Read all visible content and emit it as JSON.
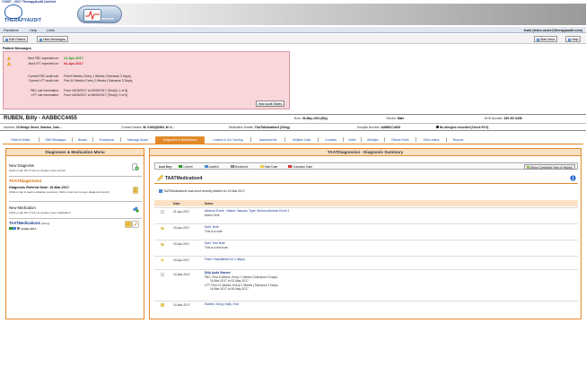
{
  "header": {
    "copyright": "©2007 - 2017 TherapyAudit Limited",
    "logo_text": "THERAPYAUDIT",
    "monitor_text": "MONITOR"
  },
  "menu": {
    "items": [
      "Functions",
      "Help",
      "Links"
    ],
    "user": "lewis (lewis.carter@therapyaudit.com)"
  },
  "toolbar": {
    "edit_patient": "Edit Patient",
    "hide_messages": "Hide Messages",
    "start_here": "Start Here",
    "help": "Help"
  },
  "patient_messages": {
    "title": "Patient Messages",
    "next_fbc_label": "Next FBC expected on:",
    "next_fbc_value": "21-Apr-2017",
    "next_lft_label": "Next LFT expected on:",
    "next_lft_value": "04-Apr-2017",
    "current_fbc_label": "Current FBC audit rule:",
    "current_fbc_value": "First 6 Weeks, Every 1 Weeks (Tolerance 3 Days)",
    "current_lft_label": "Current LFT audit rule:",
    "current_lft_value": "First 10 Weeks, Every 2 Weeks (Tolerance 3 Days)",
    "fbc_info_label": "FBC rule information:",
    "fbc_info_value": "From 16/03/2017 to 02/05/2017 (Test(s): 1 of 6)",
    "lft_info_label": "LFT rule information:",
    "lft_info_value": "From 16/03/2017 to 06/05/2017 (Test(s): 0 of 5)",
    "hide_audit_btn": "Hide Audit Tables"
  },
  "patient": {
    "name": "RUBEN, Billy - AABBCC4455",
    "born": "03-May-1910 (89y)",
    "gender": "Male",
    "nhs_number": "345 267 6458",
    "address": "10 Bridge Street, Staxton, Cam...",
    "contact": "W: 0169(0)0493, M: 0...",
    "medication": "TAATMedication4 (20mg)",
    "hospital_number": "AABBCC4455",
    "allergies": "No allergies recorded (Check Fit 5)",
    "born_label": "Born:",
    "gender_label": "Gender:",
    "nhs_label": "NHS Number:",
    "address_label": "Address:",
    "contact_label": "Contact Details:",
    "medication_label": "Medication Details:",
    "hospital_label": "Hospital Number:"
  },
  "tabs": [
    "Patient Details",
    "SMS Messages",
    "Bloods",
    "Exceptions",
    "Message Board",
    "Diagnoses & Medications",
    "Unseen & Sol. Scoring",
    "Assessments",
    "Helpline Calls",
    "Contacts",
    "Notes",
    "Allergies",
    "Patient Roles",
    "DNA Letters",
    "Reports"
  ],
  "left_panel": {
    "title": "Diagnoses & Medication Menu",
    "new_diagnosis": "New Diagnosis",
    "new_diagnosis_sub": "(Click or tap this ® icon to create a new record)",
    "diag_heading": "TAATDiagnosis4",
    "referral_title": "Diagnosis Referral Date: 10-Mar-2017",
    "referral_sub": "(Click or tap to load medication summary. Click or tap icon to open diagnosis record)",
    "new_medication": "New Medication",
    "new_medication_sub": "(Click or tap this ® icon to create a new medication)",
    "med_title": "TAATMedication4",
    "med_dose": "(20mg)",
    "med_date": "10-Mar-2017"
  },
  "right_panel": {
    "title": "TAATDiagnosis4 - Diagnosis Summary",
    "key_label": "Icon Key:",
    "keys": [
      "Current",
      "Audited",
      "Monitored",
      "Start Date",
      "Cessation Date"
    ],
    "show_combined": "(Show Combined View of Histoty)",
    "med_name": "TAATMedication4",
    "started_note": "TAATMedication4 was most recently started on 10-Mar-2017",
    "col_date": "Date",
    "col_notes": "Notes",
    "rows": [
      {
        "date": "21-Apr-2017",
        "l1": "Adverse Event - Nature: Nausea, Type: Serious Adverse Event 1",
        "l2": "Notes Here",
        "l3": "",
        "l4": ""
      },
      {
        "date": "19-Apr-2017",
        "l1": "Note: Note",
        "l2": "This is a note",
        "l3": "",
        "l4": ""
      },
      {
        "date": "19-Apr-2017",
        "l1": "Note: Test Note",
        "l2": "This is a test note",
        "l3": "",
        "l4": ""
      },
      {
        "date": "19-Apr-2017",
        "l1": "Flare: Hospitalised for 2 day(s)",
        "l2": "",
        "l3": "",
        "l4": ""
      },
      {
        "date": "10-Mar-2017",
        "l1": "DNA Audit Started",
        "l2": "FBC: First 6 Weeks, Every 1 Weeks (Tolerance 3 Days)",
        "l3": "16-Mar-2017 to 02-May-2017",
        "l4": "LFT: First 10 Weeks, Every 2 Weeks (Tolerance 3 Days)"
      },
      {
        "date": "10-Mar-2017",
        "l1": "Started: 20mg, Daily, Oral",
        "l2": "",
        "l3": "",
        "l4": ""
      }
    ],
    "lft_dates": "16-Mar-2017 to 06-May-2017"
  }
}
